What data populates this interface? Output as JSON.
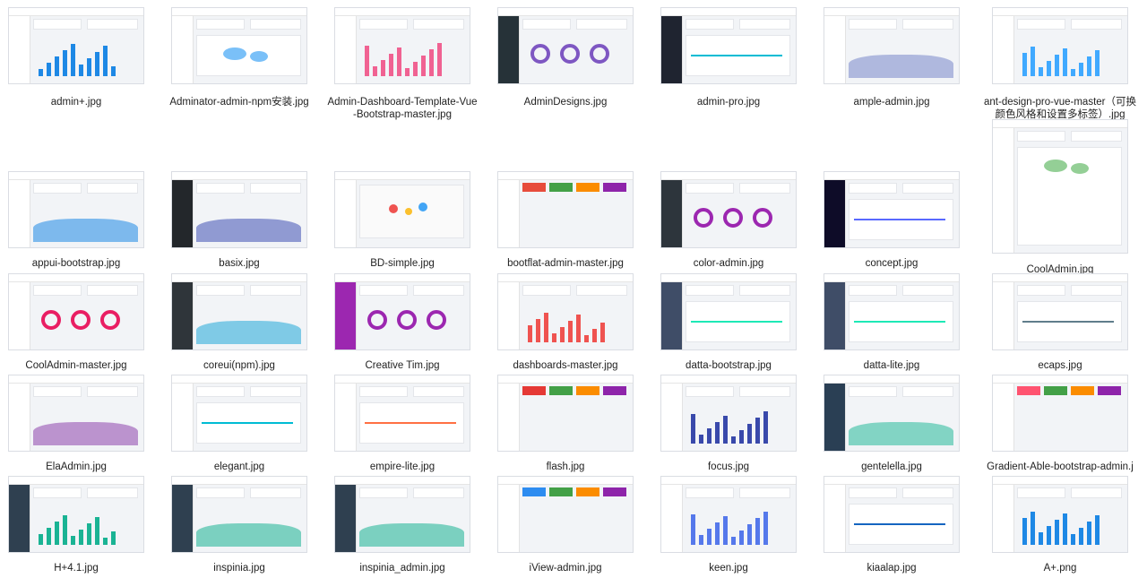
{
  "gallery": {
    "items": [
      {
        "label": "admin+.jpg",
        "theme": "#1e88e5",
        "side": "#ffffff",
        "variant": "bars"
      },
      {
        "label": "Adminator-admin-npm安装.jpg",
        "theme": "#2196f3",
        "side": "#ffffff",
        "variant": "map"
      },
      {
        "label": "Admin-Dashboard-Template-Vue-Bootstrap-master.jpg",
        "theme": "#f06292",
        "side": "#ffffff",
        "variant": "bars"
      },
      {
        "label": "AdminDesigns.jpg",
        "theme": "#7e57c2",
        "side": "#263238",
        "variant": "donuts"
      },
      {
        "label": "admin-pro.jpg",
        "theme": "#00bcd4",
        "side": "#1f2430",
        "variant": "line"
      },
      {
        "label": "ample-admin.jpg",
        "theme": "#7986cb",
        "side": "#ffffff",
        "variant": "area"
      },
      {
        "label": "ant-design-pro-vue-master（可换颜色风格和设置多标签）.jpg",
        "theme": "#40a9ff",
        "side": "#ffffff",
        "variant": "bars"
      },
      {
        "label": "CoolAdmin.jpg",
        "theme": "#4caf50",
        "side": "#ffffff",
        "variant": "map",
        "tall": true
      },
      {
        "label": "appui-bootstrap.jpg",
        "theme": "#1e88e5",
        "side": "#ffffff",
        "variant": "area"
      },
      {
        "label": "basix.jpg",
        "theme": "#3f51b5",
        "side": "#23272b",
        "variant": "area"
      },
      {
        "label": "BD-simple.jpg",
        "theme": "#ef5350",
        "side": "#ffffff",
        "variant": "illustration"
      },
      {
        "label": "bootflat-admin-master.jpg",
        "theme": "#e74c3c",
        "side": "#ffffff",
        "variant": "blocks"
      },
      {
        "label": "color-admin.jpg",
        "theme": "#9c27b0",
        "side": "#2d353c",
        "variant": "donuts"
      },
      {
        "label": "concept.jpg",
        "theme": "#5969ff",
        "side": "#0e0c28",
        "variant": "line"
      },
      {
        "label": "CoolAdmin-master.jpg",
        "theme": "#e91e63",
        "side": "#ffffff",
        "variant": "donuts"
      },
      {
        "label": "coreui(npm).jpg",
        "theme": "#20a8d8",
        "side": "#2f353a",
        "variant": "area"
      },
      {
        "label": "Creative Tim.jpg",
        "theme": "#9c27b0",
        "side": "#9c27b0",
        "variant": "donuts"
      },
      {
        "label": "dashboards-master.jpg",
        "theme": "#ef5350",
        "side": "#ffffff",
        "variant": "bars"
      },
      {
        "label": "datta-bootstrap.jpg",
        "theme": "#1de9b6",
        "side": "#3f4d67",
        "variant": "line"
      },
      {
        "label": "datta-lite.jpg",
        "theme": "#1de9b6",
        "side": "#3f4d67",
        "variant": "line"
      },
      {
        "label": "ecaps.jpg",
        "theme": "#607d8b",
        "side": "#ffffff",
        "variant": "line"
      },
      {
        "label": "ElaAdmin.jpg",
        "theme": "#8e44ad",
        "side": "#ffffff",
        "variant": "area"
      },
      {
        "label": "elegant.jpg",
        "theme": "#00bcd4",
        "side": "#ffffff",
        "variant": "line"
      },
      {
        "label": "empire-lite.jpg",
        "theme": "#ff7043",
        "side": "#ffffff",
        "variant": "line"
      },
      {
        "label": "flash.jpg",
        "theme": "#e53935",
        "side": "#ffffff",
        "variant": "blocks"
      },
      {
        "label": "focus.jpg",
        "theme": "#3949ab",
        "side": "#ffffff",
        "variant": "bars"
      },
      {
        "label": "gentelella.jpg",
        "theme": "#26b99a",
        "side": "#2a3f54",
        "variant": "area"
      },
      {
        "label": "Gradient-Able-bootstrap-admin.jpg",
        "theme": "#ff5370",
        "side": "#ffffff",
        "variant": "blocks"
      },
      {
        "label": "H+4.1.jpg",
        "theme": "#1ab394",
        "side": "#2f4050",
        "variant": "bars"
      },
      {
        "label": "inspinia.jpg",
        "theme": "#1ab394",
        "side": "#2f4050",
        "variant": "area"
      },
      {
        "label": "inspinia_admin.jpg",
        "theme": "#1ab394",
        "side": "#2f4050",
        "variant": "area"
      },
      {
        "label": "iView-admin.jpg",
        "theme": "#2d8cf0",
        "side": "#ffffff",
        "variant": "blocks"
      },
      {
        "label": "keen.jpg",
        "theme": "#5578eb",
        "side": "#ffffff",
        "variant": "bars"
      },
      {
        "label": "kiaalap.jpg",
        "theme": "#1565c0",
        "side": "#ffffff",
        "variant": "line"
      },
      {
        "label": "A+.png",
        "theme": "#1e88e5",
        "side": "#ffffff",
        "variant": "bars"
      }
    ]
  }
}
